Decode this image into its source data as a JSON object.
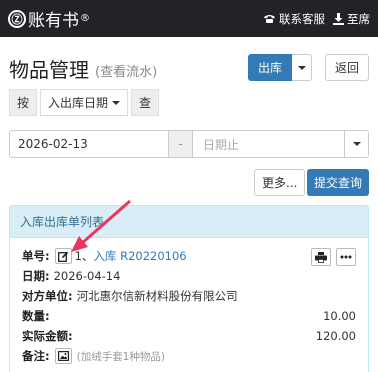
{
  "header": {
    "brand_logo": "Ⓩ",
    "brand": "账有书",
    "brand_mark": "®",
    "service": "联系客服",
    "user": "至席"
  },
  "page": {
    "title": "物品管理",
    "subtitle": "(查看流水)",
    "out_button": "出库",
    "back_button": "返回"
  },
  "filter": {
    "by_label": "按",
    "field": "入出库日期",
    "query_label": "查"
  },
  "date_range": {
    "from": "2026-02-13",
    "separator": "-",
    "to_placeholder": "日期止"
  },
  "actions": {
    "more": "更多...",
    "submit": "提交查询"
  },
  "list": {
    "title": "入库出库单列表",
    "record": {
      "doc_label": "单号:",
      "doc_prefix": "1、",
      "doc_value": "入库 R20220106",
      "date_label": "日期:",
      "date_value": "2026-04-14",
      "party_label": "对方单位:",
      "party_value": "河北惠尔信新材料股份有限公司",
      "qty_label": "数量:",
      "qty_value": "10.00",
      "amount_label": "实际金额:",
      "amount_value": "120.00",
      "note_label": "备注:",
      "note_value": "(加绒手套1种物品)"
    }
  },
  "colors": {
    "topbar": "#222326",
    "primary": "#337ab7",
    "panel_head": "#d9edf7",
    "annotation_arrow": "#e8365d"
  }
}
